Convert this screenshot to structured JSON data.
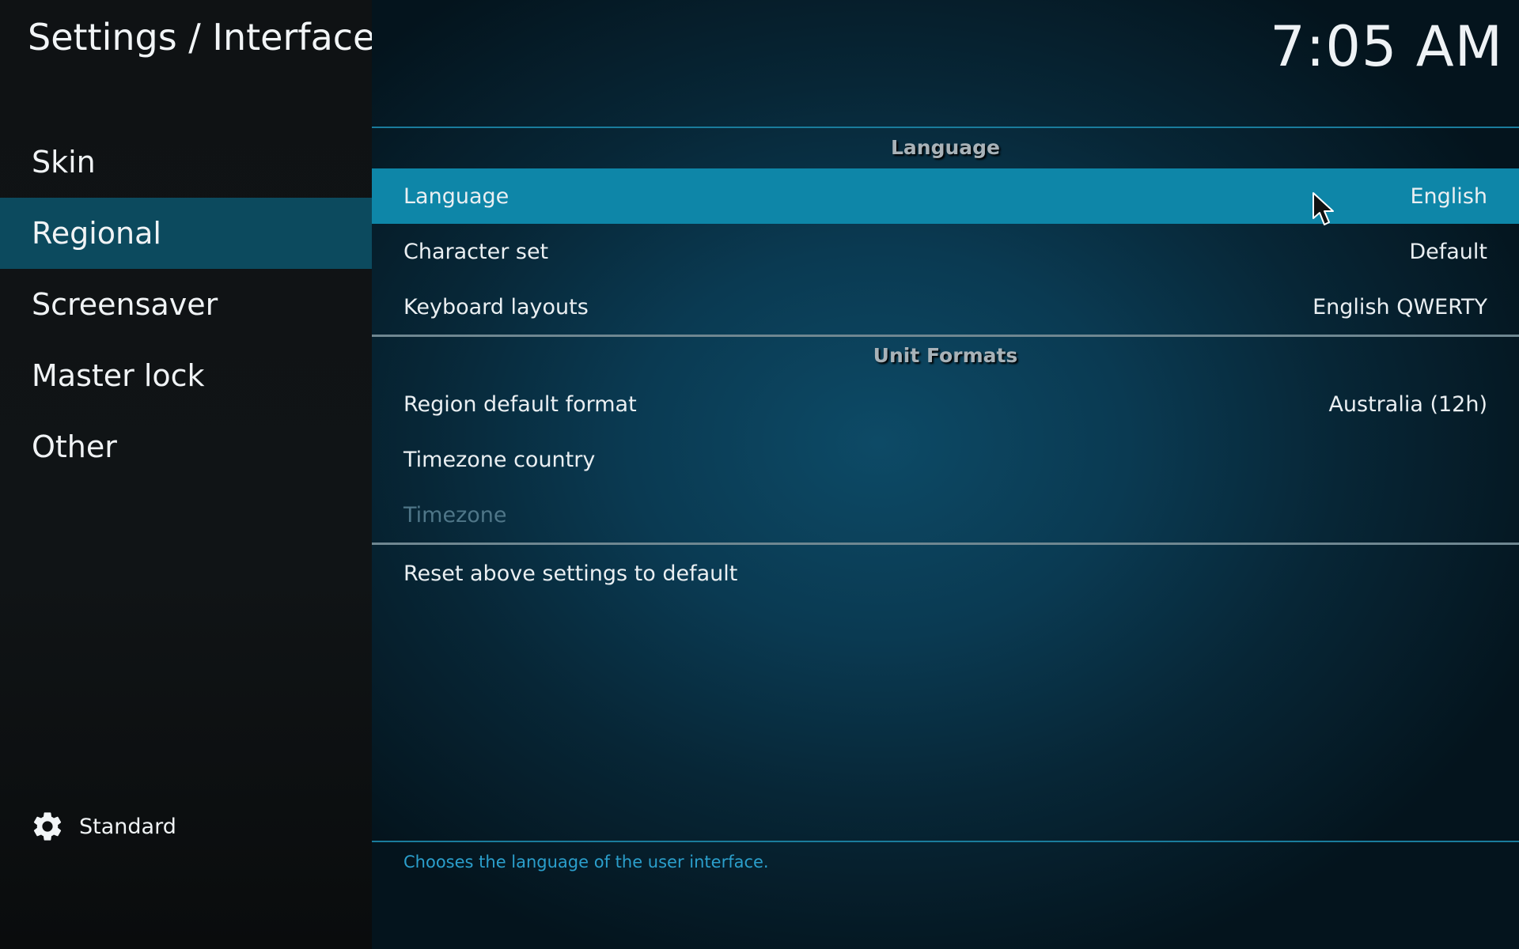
{
  "header": {
    "title": "Settings / Interface",
    "clock": "7:05 AM"
  },
  "sidebar": {
    "items": [
      {
        "label": "Skin",
        "selected": false
      },
      {
        "label": "Regional",
        "selected": true
      },
      {
        "label": "Screensaver",
        "selected": false
      },
      {
        "label": "Master lock",
        "selected": false
      },
      {
        "label": "Other",
        "selected": false
      }
    ],
    "level": {
      "icon": "gear-icon",
      "label": "Standard"
    }
  },
  "groups": {
    "language": {
      "header": "Language",
      "rows": [
        {
          "label": "Language",
          "value": "English",
          "focused": true
        },
        {
          "label": "Character set",
          "value": "Default"
        },
        {
          "label": "Keyboard layouts",
          "value": "English QWERTY"
        }
      ]
    },
    "unit_formats": {
      "header": "Unit Formats",
      "rows": [
        {
          "label": "Region default format",
          "value": "Australia (12h)"
        },
        {
          "label": "Timezone country",
          "value": ""
        },
        {
          "label": "Timezone",
          "value": "",
          "disabled": true
        }
      ]
    },
    "reset": {
      "label": "Reset above settings to default"
    }
  },
  "description": "Chooses the language of the user interface.",
  "colors": {
    "accent": "#0e86a8",
    "sidebar_selected": "#0c4a5e",
    "description_text": "#2b9fcc"
  }
}
